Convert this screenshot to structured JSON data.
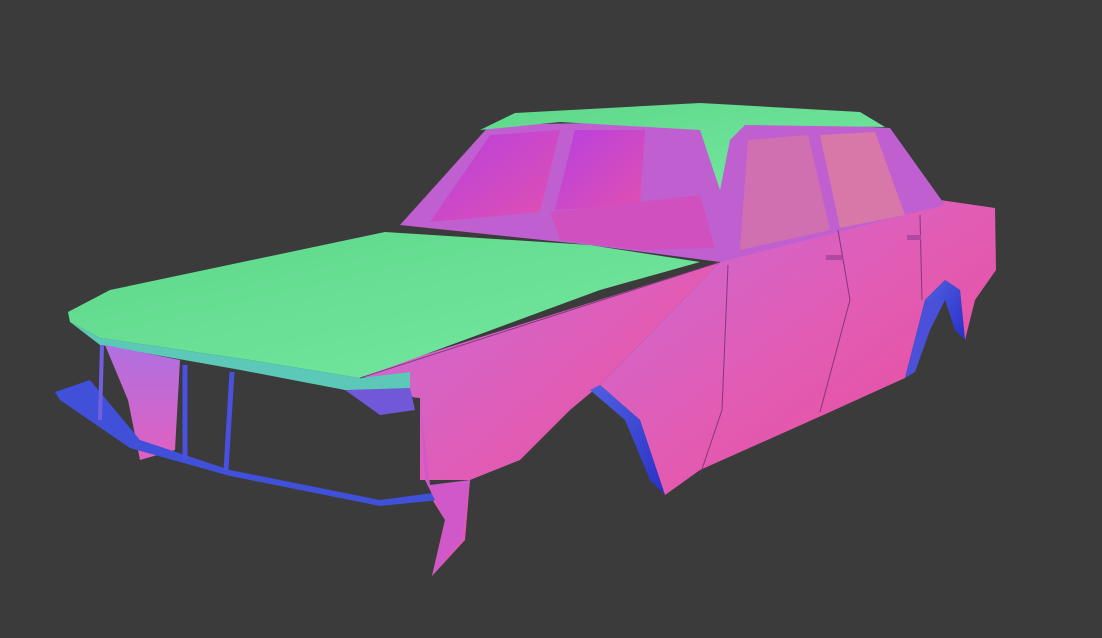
{
  "scene": {
    "subject": "car-body-normal-map-render",
    "colors": {
      "background": "#3b3b3b",
      "up_facing": "#66e08a",
      "side_facing": "#e060b8",
      "front_facing": "#8060e8",
      "deep_blue": "#3a40d8",
      "window": "#c040d8"
    }
  }
}
